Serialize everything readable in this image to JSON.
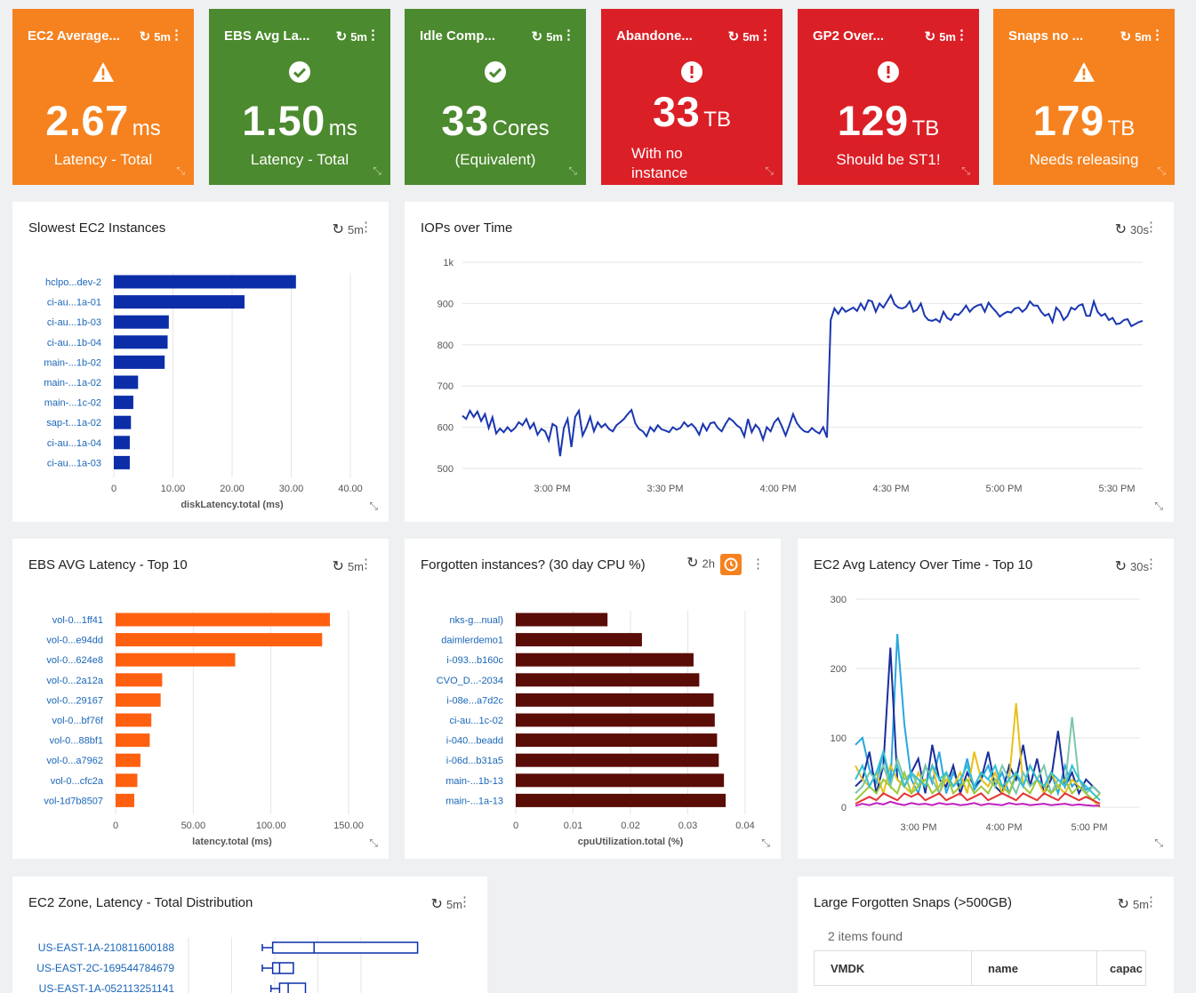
{
  "colors": {
    "orange": "#f5821f",
    "green": "#4b8a2e",
    "red": "#db1f26",
    "bar_blue": "#0b2ea8",
    "line_blue": "#1a36b0",
    "bar_orange": "#ff6010",
    "bar_maroon": "#5a0c06"
  },
  "kpis": [
    {
      "title": "EC2 Average...",
      "refresh": "5m",
      "icon": "warning-icon",
      "value": "2.67",
      "unit": "ms",
      "subtitle": "Latency - Total",
      "color": "orange"
    },
    {
      "title": "EBS Avg La...",
      "refresh": "5m",
      "icon": "check-circle-icon",
      "value": "1.50",
      "unit": "ms",
      "subtitle": "Latency - Total",
      "color": "green"
    },
    {
      "title": "Idle Comp...",
      "refresh": "5m",
      "icon": "check-circle-icon",
      "value": "33",
      "unit": "Cores",
      "subtitle": "(Equivalent)",
      "color": "green"
    },
    {
      "title": "Abandone...",
      "refresh": "5m",
      "icon": "error-circle-icon",
      "value": "33",
      "unit": "TB",
      "subtitle_line1": "With no",
      "subtitle_line2": "instance",
      "color": "red"
    },
    {
      "title": "GP2 Over...",
      "refresh": "5m",
      "icon": "error-circle-icon",
      "value": "129",
      "unit": "TB",
      "subtitle": "Should be ST1!",
      "color": "red"
    },
    {
      "title": "Snaps no ...",
      "refresh": "5m",
      "icon": "warning-icon",
      "value": "179",
      "unit": "TB",
      "subtitle": "Needs releasing",
      "color": "orange"
    }
  ],
  "panels": {
    "slowest": {
      "title": "Slowest EC2 Instances",
      "refresh": "5m"
    },
    "iops": {
      "title": "IOPs over Time",
      "refresh": "30s"
    },
    "ebs": {
      "title": "EBS AVG Latency - Top 10",
      "refresh": "5m"
    },
    "forgotten": {
      "title": "Forgotten instances? (30 day CPU %)",
      "refresh": "2h"
    },
    "ec2time": {
      "title": "EC2 Avg Latency Over Time - Top 10",
      "refresh": "30s"
    },
    "zone": {
      "title": "EC2 Zone, Latency - Total Distribution",
      "refresh": "5m"
    },
    "snaps": {
      "title": "Large Forgotten Snaps (>500GB)",
      "refresh": "5m",
      "count_text": "2 items found",
      "columns": [
        "VMDK",
        "name",
        "capac"
      ]
    }
  },
  "chart_data": [
    {
      "id": "slowest",
      "type": "bar",
      "orientation": "horizontal",
      "categories": [
        "hclpo...dev-2",
        "ci-au...1a-01",
        "ci-au...1b-03",
        "ci-au...1b-04",
        "main-...1b-02",
        "main-...1a-02",
        "main-...1c-02",
        "sap-t...1a-02",
        "ci-au...1a-04",
        "ci-au...1a-03"
      ],
      "values": [
        30.8,
        22.1,
        9.3,
        9.1,
        8.6,
        4.1,
        3.3,
        2.9,
        2.7,
        2.7
      ],
      "xlim": [
        0,
        40
      ],
      "xticks": [
        "0",
        "10.00",
        "20.00",
        "30.00",
        "40.00"
      ],
      "xlabel": "diskLatency.total (ms)"
    },
    {
      "id": "iops",
      "type": "line",
      "xlabel": "",
      "ylabel": "",
      "ylim": [
        500,
        1000
      ],
      "yticks": [
        "1k",
        "900",
        "800",
        "700",
        "600",
        "500"
      ],
      "xticks": [
        "3:00 PM",
        "3:30 PM",
        "4:00 PM",
        "4:30 PM",
        "5:00 PM",
        "5:30 PM"
      ],
      "series": [
        {
          "values": [
            628,
            620,
            640,
            625,
            638,
            615,
            632,
            598,
            624,
            585,
            597,
            588,
            600,
            590,
            598,
            612,
            605,
            620,
            597,
            610,
            582,
            596,
            590,
            568,
            608,
            602,
            530,
            598,
            620,
            552,
            625,
            640,
            580,
            600,
            625,
            590,
            612,
            600,
            608,
            596,
            590,
            605,
            612,
            620,
            632,
            642,
            610,
            596,
            590,
            578,
            600,
            590,
            605,
            595,
            592,
            588,
            600,
            594,
            598,
            612,
            602,
            608,
            598,
            582,
            608,
            592,
            610,
            612,
            598,
            590,
            608,
            622,
            615,
            605,
            598,
            578,
            620,
            588,
            606,
            596,
            570,
            600,
            590,
            612,
            622,
            602,
            580,
            605,
            632,
            610,
            598,
            590,
            588,
            598,
            590,
            585,
            600,
            575,
            860,
            888,
            875,
            890,
            880,
            885,
            890,
            882,
            900,
            885,
            908,
            905,
            880,
            900,
            890,
            905,
            920,
            898,
            890,
            888,
            892,
            905,
            880,
            885,
            900,
            870,
            860,
            858,
            862,
            855,
            880,
            865,
            860,
            875,
            872,
            882,
            895,
            880,
            890,
            895,
            898,
            880,
            902,
            890,
            880,
            868,
            875,
            880,
            878,
            888,
            890,
            880,
            888,
            905,
            895,
            895,
            880,
            870,
            875,
            855,
            890,
            880,
            860,
            870,
            890,
            885,
            895,
            898,
            870,
            870,
            905,
            880,
            870,
            875,
            860,
            865,
            850,
            852,
            860,
            862,
            845,
            850,
            855,
            858
          ]
        }
      ]
    },
    {
      "id": "ebs",
      "type": "bar",
      "orientation": "horizontal",
      "categories": [
        "vol-0...1ff41",
        "vol-0...e94dd",
        "vol-0...624e8",
        "vol-0...2a12a",
        "vol-0...29167",
        "vol-0...bf76f",
        "vol-0...88bf1",
        "vol-0...a7962",
        "vol-0...cfc2a",
        "vol-1d7b8507"
      ],
      "values": [
        138,
        133,
        77,
        30,
        29,
        23,
        22,
        16,
        14,
        12
      ],
      "xlim": [
        0,
        150
      ],
      "xticks": [
        "0",
        "50.00",
        "100.00",
        "150.00"
      ],
      "xlabel": "latency.total (ms)"
    },
    {
      "id": "forgotten",
      "type": "bar",
      "orientation": "horizontal",
      "categories": [
        "nks-g...nual)",
        "daimlerdemo1",
        "i-093...b160c",
        "CVO_D...-2034",
        "i-08e...a7d2c",
        "ci-au...1c-02",
        "i-040...beadd",
        "i-06d...b31a5",
        "main-...1b-13",
        "main-...1a-13"
      ],
      "values": [
        0.016,
        0.022,
        0.031,
        0.032,
        0.0345,
        0.0347,
        0.0351,
        0.0354,
        0.0363,
        0.0366
      ],
      "xlim": [
        0,
        0.04
      ],
      "xticks": [
        "0",
        "0.01",
        "0.02",
        "0.03",
        "0.04"
      ],
      "xlabel": "cpuUtilization.total (%)"
    },
    {
      "id": "ec2time",
      "type": "line",
      "ylim": [
        0,
        300
      ],
      "yticks": [
        "300",
        "200",
        "100",
        "0"
      ],
      "xticks": [
        "3:00 PM",
        "4:00 PM",
        "5:00 PM"
      ],
      "series": [
        {
          "color": "#2aa6e0",
          "values": [
            90,
            100,
            55,
            35,
            80,
            30,
            250,
            120,
            40,
            20,
            60,
            35,
            80,
            20,
            50,
            30,
            70,
            25,
            40,
            60,
            30,
            50,
            20,
            45,
            30,
            60,
            40,
            30,
            50,
            20,
            60,
            30,
            40,
            25,
            30,
            20
          ]
        },
        {
          "color": "#1a2e9a",
          "values": [
            30,
            40,
            80,
            20,
            60,
            230,
            40,
            30,
            50,
            70,
            20,
            90,
            40,
            30,
            60,
            20,
            50,
            30,
            40,
            80,
            30,
            20,
            60,
            40,
            90,
            30,
            70,
            20,
            40,
            110,
            30,
            50,
            20,
            40,
            30,
            20
          ]
        },
        {
          "color": "#e8c01a",
          "values": [
            60,
            40,
            30,
            50,
            20,
            60,
            40,
            30,
            20,
            50,
            30,
            60,
            20,
            40,
            30,
            50,
            20,
            80,
            40,
            30,
            50,
            20,
            40,
            150,
            30,
            60,
            40,
            20,
            50,
            30,
            20,
            40,
            30,
            20,
            10,
            0
          ]
        },
        {
          "color": "#7cc6a8",
          "values": [
            20,
            30,
            50,
            40,
            60,
            30,
            70,
            40,
            50,
            30,
            60,
            40,
            20,
            50,
            30,
            40,
            60,
            30,
            50,
            40,
            30,
            60,
            40,
            20,
            50,
            30,
            40,
            60,
            20,
            40,
            30,
            130,
            40,
            20,
            30,
            20
          ]
        },
        {
          "color": "#9ac93a",
          "values": [
            10,
            20,
            30,
            20,
            40,
            30,
            20,
            50,
            20,
            30,
            40,
            20,
            30,
            50,
            20,
            30,
            40,
            20,
            30,
            20,
            40,
            30,
            20,
            50,
            30,
            20,
            40,
            30,
            20,
            30,
            40,
            20,
            30,
            20,
            10,
            20
          ]
        },
        {
          "color": "#e53535",
          "values": [
            5,
            10,
            15,
            10,
            20,
            15,
            10,
            20,
            15,
            20,
            10,
            15,
            20,
            10,
            15,
            20,
            10,
            15,
            20,
            10,
            15,
            20,
            15,
            10,
            20,
            15,
            10,
            20,
            15,
            10,
            20,
            15,
            10,
            15,
            10,
            5
          ]
        },
        {
          "color": "#c020c0",
          "values": [
            2,
            5,
            3,
            6,
            4,
            8,
            5,
            3,
            6,
            4,
            5,
            3,
            6,
            4,
            5,
            3,
            4,
            6,
            3,
            5,
            4,
            3,
            6,
            4,
            5,
            3,
            4,
            5,
            3,
            4,
            5,
            3,
            4,
            3,
            2,
            2
          ]
        },
        {
          "color": "#30c0d8",
          "values": [
            40,
            60,
            30,
            50,
            80,
            40,
            60,
            30,
            50,
            40,
            30,
            60,
            40,
            50,
            30,
            40,
            60,
            30,
            50,
            40,
            60,
            30,
            40,
            50,
            30,
            60,
            40,
            30,
            50,
            40,
            30,
            60,
            40,
            30,
            20,
            10
          ]
        }
      ]
    },
    {
      "id": "zone",
      "type": "boxplot",
      "orientation": "horizontal",
      "categories": [
        "US-EAST-1A-210811600188",
        "US-EAST-2C-169544784679",
        "US-EAST-1A-052113251141"
      ],
      "boxes": [
        {
          "min": 0.0,
          "q1": 0.06,
          "median": 0.3,
          "q3": 0.9
        },
        {
          "min": 0.0,
          "q1": 0.06,
          "median": 0.1,
          "q3": 0.18
        },
        {
          "min": 0.05,
          "q1": 0.1,
          "median": 0.15,
          "q3": 0.25
        }
      ]
    }
  ]
}
